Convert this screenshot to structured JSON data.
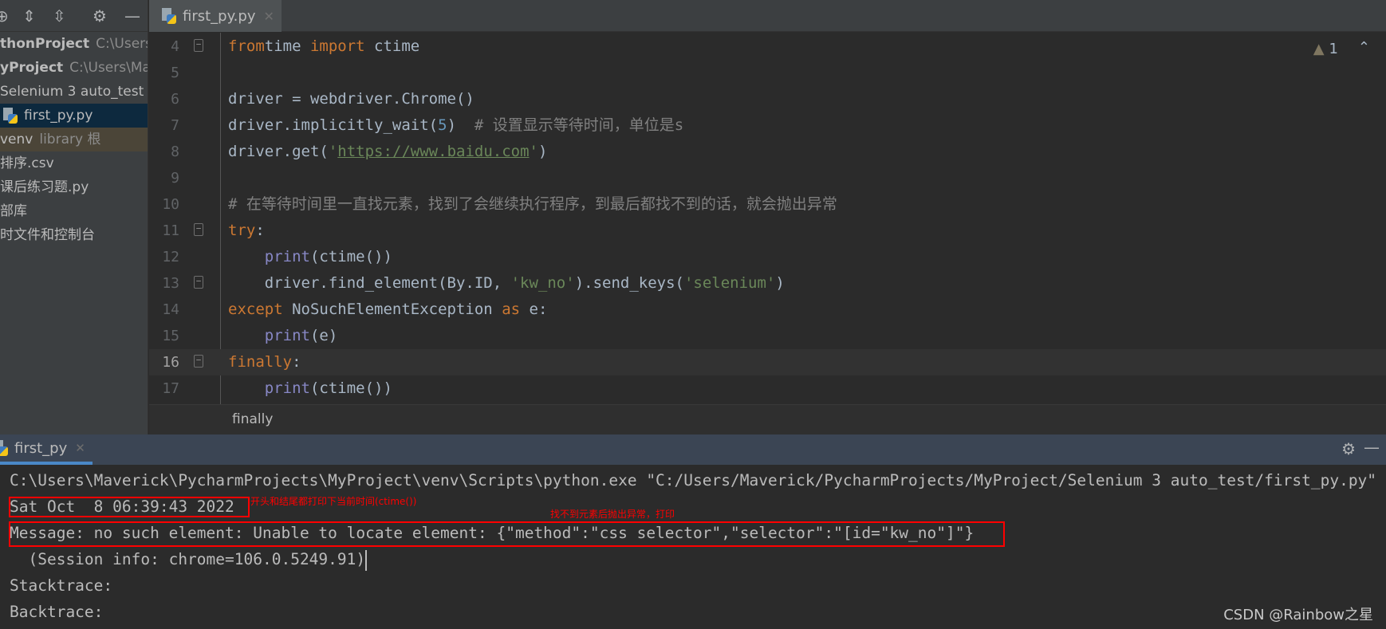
{
  "sidebar": {
    "toolbar_icons": [
      "locate-icon",
      "expand-all-icon",
      "collapse-all-icon",
      "gear-icon",
      "minimize-icon"
    ],
    "items": [
      {
        "label": "thonProject",
        "hint": "C:\\Users\\",
        "style": "bold"
      },
      {
        "label": "yProject",
        "hint": "C:\\Users\\Mav",
        "style": "bold"
      },
      {
        "label": "Selenium 3 auto_test",
        "hint": "",
        "style": ""
      },
      {
        "label": "first_py.py",
        "hint": "",
        "style": "sel"
      },
      {
        "label": "venv",
        "hint": "library 根",
        "style": "venv"
      },
      {
        "label": "排序.csv",
        "hint": "",
        "style": ""
      },
      {
        "label": "课后练习题.py",
        "hint": "",
        "style": ""
      },
      {
        "label": "部库",
        "hint": "",
        "style": ""
      },
      {
        "label": "时文件和控制台",
        "hint": "",
        "style": ""
      }
    ]
  },
  "editor": {
    "tab_label": "first_py.py",
    "warning_count": "1",
    "current_line": 16,
    "lines": [
      {
        "n": "4",
        "fold": true,
        "segs": [
          [
            "kw",
            "from"
          ],
          [
            "",
            "time "
          ],
          [
            "kw",
            "import"
          ],
          [
            "",
            " ctime"
          ]
        ]
      },
      {
        "n": "5",
        "segs": []
      },
      {
        "n": "6",
        "segs": [
          [
            "",
            "driver = webdriver.Chrome()"
          ]
        ]
      },
      {
        "n": "7",
        "segs": [
          [
            "",
            "driver.implicitly_wait("
          ],
          [
            "num",
            "5"
          ],
          [
            "",
            ")  "
          ],
          [
            "cm",
            "# 设置显示等待时间，单位是s"
          ]
        ]
      },
      {
        "n": "8",
        "segs": [
          [
            "",
            "driver.get("
          ],
          [
            "str",
            "'"
          ],
          [
            "url",
            "https://www.baidu.com"
          ],
          [
            "str",
            "'"
          ],
          [
            "",
            ")"
          ]
        ]
      },
      {
        "n": "9",
        "segs": []
      },
      {
        "n": "10",
        "segs": [
          [
            "cm",
            "# 在等待时间里一直找元素，找到了会继续执行程序，到最后都找不到的话，就会抛出异常"
          ]
        ]
      },
      {
        "n": "11",
        "fold": true,
        "segs": [
          [
            "kw",
            "try"
          ],
          [
            "",
            ":"
          ]
        ]
      },
      {
        "n": "12",
        "segs": [
          [
            "",
            "    "
          ],
          [
            "bi",
            "print"
          ],
          [
            "",
            "(ctime())"
          ]
        ]
      },
      {
        "n": "13",
        "fold": true,
        "segs": [
          [
            "",
            "    driver.find_element(By.ID, "
          ],
          [
            "str",
            "'kw_no'"
          ],
          [
            "",
            ").send_keys("
          ],
          [
            "str",
            "'selenium'"
          ],
          [
            "",
            ")"
          ]
        ]
      },
      {
        "n": "14",
        "segs": [
          [
            "kw",
            "except"
          ],
          [
            "",
            " NoSuchElementException "
          ],
          [
            "kw",
            "as"
          ],
          [
            "",
            " e:"
          ]
        ]
      },
      {
        "n": "15",
        "segs": [
          [
            "",
            "    "
          ],
          [
            "bi",
            "print"
          ],
          [
            "",
            "(e)"
          ]
        ]
      },
      {
        "n": "16",
        "fold": true,
        "segs": [
          [
            "kw",
            "finally"
          ],
          [
            "",
            ":"
          ]
        ]
      },
      {
        "n": "17",
        "segs": [
          [
            "",
            "    "
          ],
          [
            "bi",
            "print"
          ],
          [
            "",
            "(ctime())"
          ]
        ]
      }
    ],
    "breadcrumb": "finally"
  },
  "run": {
    "tab_label": "first_py",
    "output": [
      "C:\\Users\\Maverick\\PycharmProjects\\MyProject\\venv\\Scripts\\python.exe \"C:/Users/Maverick/PycharmProjects/MyProject/Selenium 3 auto_test/first_py.py\"",
      "Sat Oct  8 06:39:43 2022",
      "Message: no such element: Unable to locate element: {\"method\":\"css selector\",\"selector\":\"[id=\"kw_no\"]\"}",
      "  (Session info: chrome=106.0.5249.91)",
      "Stacktrace:",
      "Backtrace:"
    ]
  },
  "annotations": {
    "note1": "开头和结尾都打印下当前时间(ctime())",
    "note2": "找不到元素后抛出异常，打印",
    "color": "#ff0000"
  },
  "watermark": "CSDN @Rainbow之星"
}
